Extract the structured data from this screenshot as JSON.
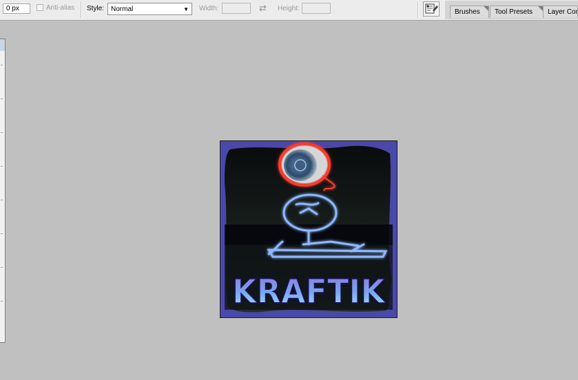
{
  "options_bar": {
    "feather_value": "0 px",
    "anti_alias_label": "Anti-alias",
    "anti_alias_checked": false,
    "style_label": "Style:",
    "style_value": "Normal",
    "width_label": "Width:",
    "width_value": "",
    "height_label": "Height:",
    "height_value": ""
  },
  "panel_tabs": [
    "Brushes",
    "Tool Presets",
    "Layer Con"
  ],
  "canvas": {
    "logo_text": "KRAFTIK"
  },
  "icons": {
    "swap": "swap-width-height-icon",
    "tool_options": "tool-palette-icon",
    "dropdown": "chevron-down-icon"
  },
  "colors": {
    "workspace": "#c0c0c0",
    "toolbar": "#ececec",
    "frame_purple": "#4a48a8",
    "glow_blue": "#8fb8ff",
    "glow_red": "#ff3a2a"
  }
}
